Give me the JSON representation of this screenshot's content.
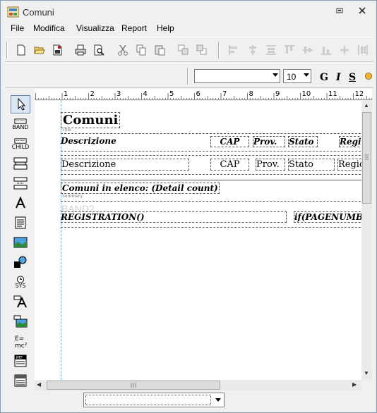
{
  "window": {
    "title": "Comuni"
  },
  "menu": [
    "File",
    "Modifica",
    "Visualizza",
    "Report",
    "Help"
  ],
  "toolbar2": {
    "font_name": "",
    "font_size": "10",
    "bold": "G",
    "italic": "I",
    "underline": "S"
  },
  "palette_labels": {
    "band": "BAND",
    "child": "CHILD",
    "sys": "SYS"
  },
  "ruler": {
    "numbers": [
      "1",
      "2",
      "3",
      "4",
      "5",
      "6",
      "7",
      "8",
      "9",
      "10",
      "11",
      "12"
    ]
  },
  "report": {
    "title": "Comuni",
    "title_band_tag": "Title",
    "header_fields": [
      "Descrizione",
      "CAP",
      "Prov.",
      "Stato",
      "Regi"
    ],
    "detail_fields": [
      "Descrizione",
      "CAP",
      "Prov.",
      "Stato",
      "Regio"
    ],
    "summary_text": "Comuni in elenco: (Detail count)",
    "summary_tag": "Summary",
    "band_ghost": "BAND2",
    "footer_left": "REGISTRATION()",
    "footer_right": "if(PAGENUMBE"
  },
  "statusbar": {
    "combo_value": ""
  }
}
